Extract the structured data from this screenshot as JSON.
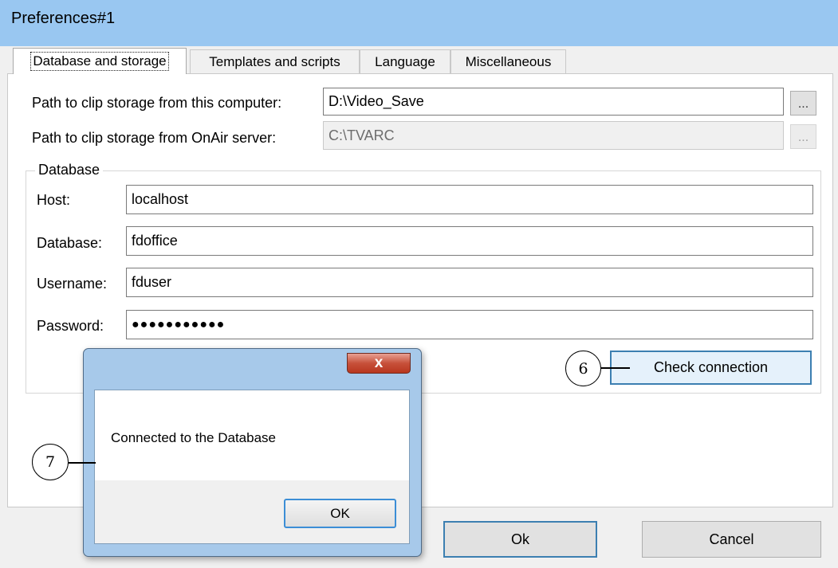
{
  "window": {
    "title": "Preferences#1"
  },
  "tabs": [
    {
      "label": "Database and storage",
      "active": true
    },
    {
      "label": "Templates and scripts",
      "active": false
    },
    {
      "label": "Language",
      "active": false
    },
    {
      "label": "Miscellaneous",
      "active": false
    }
  ],
  "storage": {
    "local_label": "Path to clip storage from this computer:",
    "local_value": "D:\\Video_Save",
    "server_label": "Path to clip storage from OnAir server:",
    "server_value": "C:\\TVARC",
    "browse_label": "..."
  },
  "database": {
    "legend": "Database",
    "host_label": "Host:",
    "host_value": "localhost",
    "database_label": "Database:",
    "database_value": "fdoffice",
    "username_label": "Username:",
    "username_value": "fduser",
    "password_label": "Password:",
    "password_value": "●●●●●●●●●●●",
    "check_button": "Check connection"
  },
  "footer": {
    "ok_label": "Ok",
    "cancel_label": "Cancel"
  },
  "message_box": {
    "close_label": "x",
    "text": "Connected to the Database",
    "ok_label": "OK"
  },
  "callouts": {
    "check": "6",
    "message": "7"
  },
  "colors": {
    "titlebar": "#99c7f1",
    "focus_border": "#3c7fb1",
    "close_button": "#c7503a"
  }
}
